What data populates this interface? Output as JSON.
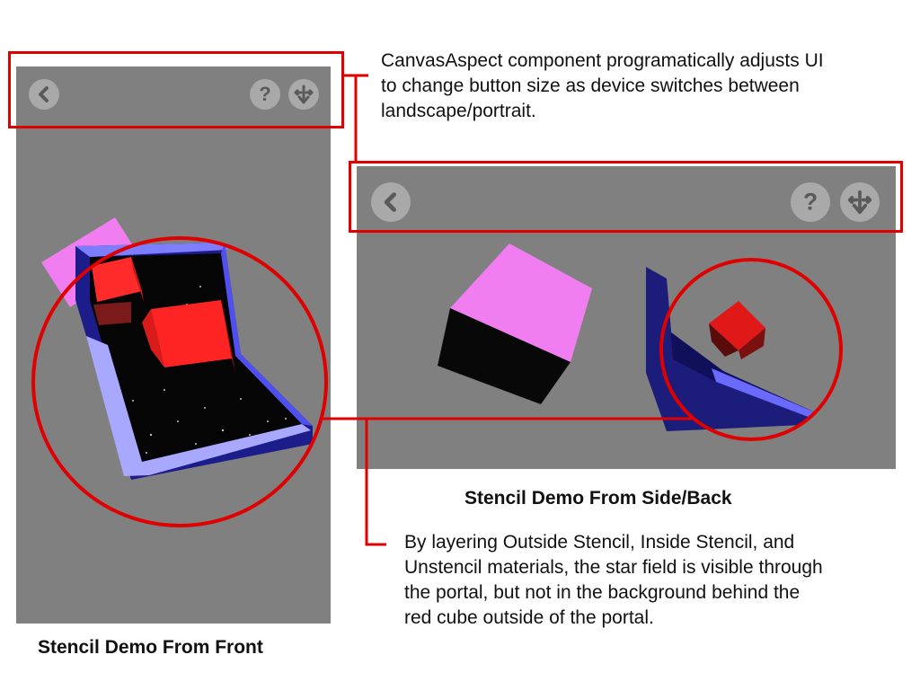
{
  "annotations": {
    "top": {
      "line1": "CanvasAspect component programatically adjusts UI",
      "line2": "to change button size as device switches between",
      "line3": "landscape/portrait."
    },
    "bottom": {
      "line1": "By layering Outside Stencil, Inside Stencil, and",
      "line2": "Unstencil materials, the star field is visible through",
      "line3": "the portal, but not in the background behind the",
      "line4": "red cube outside of the portal."
    }
  },
  "captions": {
    "front": "Stencil Demo From Front",
    "side": "Stencil Demo From Side/Back"
  },
  "colors": {
    "highlight": "#e00000",
    "panel_bg": "#808080",
    "button_bg": "#a9a9a9",
    "portal_frame": "#1a1a8c",
    "portal_rim": "#b0b0ff",
    "cube_red": "#ff2020",
    "cube_pink": "#f080f0"
  },
  "icons": {
    "back": "back-arrow-icon",
    "help": "question-mark-icon",
    "menu": "download-arrows-icon"
  }
}
